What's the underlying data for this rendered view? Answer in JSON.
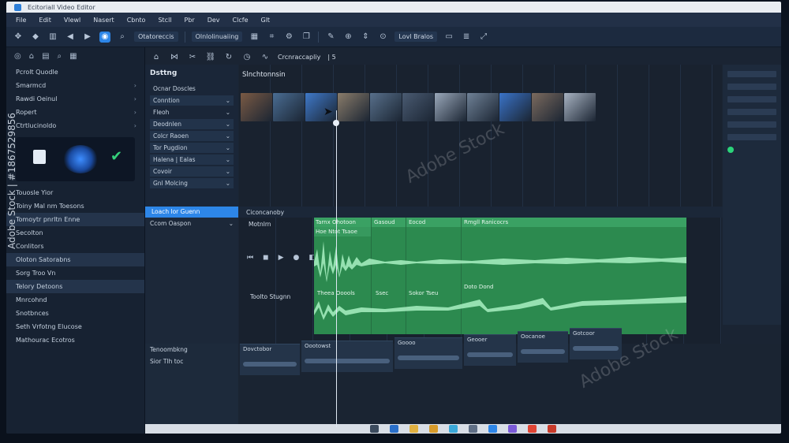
{
  "window": {
    "title": "Ecitoriall Video Editor"
  },
  "menubar": {
    "items": [
      "File",
      "Edit",
      "Vlewl",
      "Nasert",
      "Cbnto",
      "Stcll",
      "Pbr",
      "Dev",
      "Clcfe",
      "Glt"
    ]
  },
  "toolbar": {
    "item_label": "Olnlolinuaiing",
    "search_label": "Otatoreccis",
    "load_label": "Lovl Bralos"
  },
  "toolbar2": {
    "tab_label": "Crcnraccapliy",
    "counter": "| 5"
  },
  "sidebar": {
    "section_label": "Pcrolt Quodle",
    "items": [
      {
        "label": "Smarmcd"
      },
      {
        "label": "Rawdi Oeinul"
      },
      {
        "label": "Ropert"
      },
      {
        "label": "Ctrtlucinoldo"
      }
    ],
    "middle_items": [
      {
        "label": "Touosle Yior"
      },
      {
        "label": "Toiny Mal nm Toesons"
      },
      {
        "label": "Tomoytr pnrltn Enne"
      },
      {
        "label": "Secolton"
      },
      {
        "label": "Conlitors"
      },
      {
        "label": "Oloton Satorabns"
      },
      {
        "label": "Sorg Troo Vn"
      },
      {
        "label": "Telory Detoons"
      },
      {
        "label": "Mnrcohnd"
      },
      {
        "label": "Snotbnces"
      },
      {
        "label": "Seth Vrfotng Elucose"
      },
      {
        "label": "Mathourac Ecotros"
      }
    ]
  },
  "browser": {
    "title": "Dsttng",
    "media_label": "Ocnar Doscles",
    "rows": [
      {
        "label": "Conntion"
      },
      {
        "label": "Fleoh"
      },
      {
        "label": "Deodnlen"
      },
      {
        "label": "Colcr Raoen"
      },
      {
        "label": "Tor Pugdion"
      },
      {
        "label": "Halena | Ealas"
      },
      {
        "label": "Covoir"
      },
      {
        "label": "Gnl Molcing"
      }
    ]
  },
  "clips": {
    "title": "Slnchtonnsin",
    "thumb_colors": [
      "#7a5a44",
      "#4a6d93",
      "#3f79c9",
      "#8a7c6a",
      "#58708b",
      "#4a5b72",
      "#9aa8ba",
      "#6f8196",
      "#3a73c8",
      "#7b6a5e",
      "#a8b3c2"
    ]
  },
  "timeline": {
    "active_tab": "Loach lor Guenn",
    "header_label": "Ciconcanoby",
    "track_head_label": "Ccom Oaspon",
    "track_name_a": "Motnlrn",
    "track_name_b": "Toolto Stugnn",
    "region_headers": [
      "Tarnx Ohotoon",
      "Gasoud",
      "Eocod",
      "Rmgll Ranicocrs"
    ],
    "region_sub": "Hoe Ntot Tsaoe",
    "region_lower": [
      "Theea Ooools",
      "Ssec",
      "Sokor Tseu",
      "Doto Dond"
    ]
  },
  "lower": {
    "head_label": "Tenoombkng",
    "head_sub": "Sior Tlh toc",
    "lanes": [
      "Dovctobor",
      "Oootowst",
      "Goooo",
      "Geooer",
      "Oocanoe",
      "Gotcoor"
    ]
  },
  "taskbar": {
    "icon_colors": [
      "#3c4b5e",
      "#2a6fc9",
      "#e0b040",
      "#d69a2a",
      "#3aa8d8",
      "#5f6f86",
      "#2d86e8",
      "#7a5ad8",
      "#e04434",
      "#c83a2a"
    ]
  },
  "watermark": {
    "side_id": "Adobe Stock | #1867529856",
    "overlay": "Adobe Stock"
  }
}
